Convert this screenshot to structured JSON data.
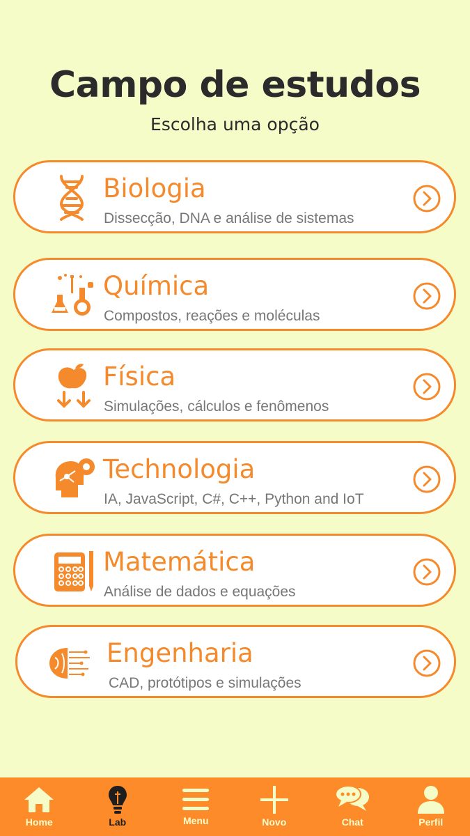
{
  "header": {
    "title": "Campo de estudos",
    "subtitle": "Escolha uma opção"
  },
  "cards": [
    {
      "title": "Biologia",
      "description": "Dissecção, DNA e análise de sistemas",
      "icon": "dna-icon"
    },
    {
      "title": "Química",
      "description": "Compostos, reações e moléculas",
      "icon": "chemistry-flask-icon"
    },
    {
      "title": "Física",
      "description": "Simulações, cálculos e fenômenos",
      "icon": "falling-apple-icon"
    },
    {
      "title": "Technologia",
      "description": "IA, JavaScript, C#, C++, Python and IoT",
      "icon": "ai-head-gear-icon"
    },
    {
      "title": "Matemática",
      "description": "Análise de dados e equações",
      "icon": "calculator-pencil-icon"
    },
    {
      "title": "Engenharia",
      "description": "CAD, protótipos e simulações",
      "icon": "circuit-brain-icon"
    }
  ],
  "nav": {
    "items": [
      {
        "label": "Home",
        "icon": "home-icon"
      },
      {
        "label": "Lab",
        "icon": "lightbulb-icon",
        "active": true
      },
      {
        "label": "Menu",
        "icon": "hamburger-menu-icon"
      },
      {
        "label": "Novo",
        "icon": "plus-icon"
      },
      {
        "label": "Chat",
        "icon": "chat-bubbles-icon"
      },
      {
        "label": "Perfil",
        "icon": "user-profile-icon"
      }
    ]
  },
  "colors": {
    "background": "#f5fcc8",
    "accent": "#f58a2c",
    "nav_background": "#fd8b2a",
    "title_text": "#2b2b2b",
    "description_text": "#777777"
  }
}
